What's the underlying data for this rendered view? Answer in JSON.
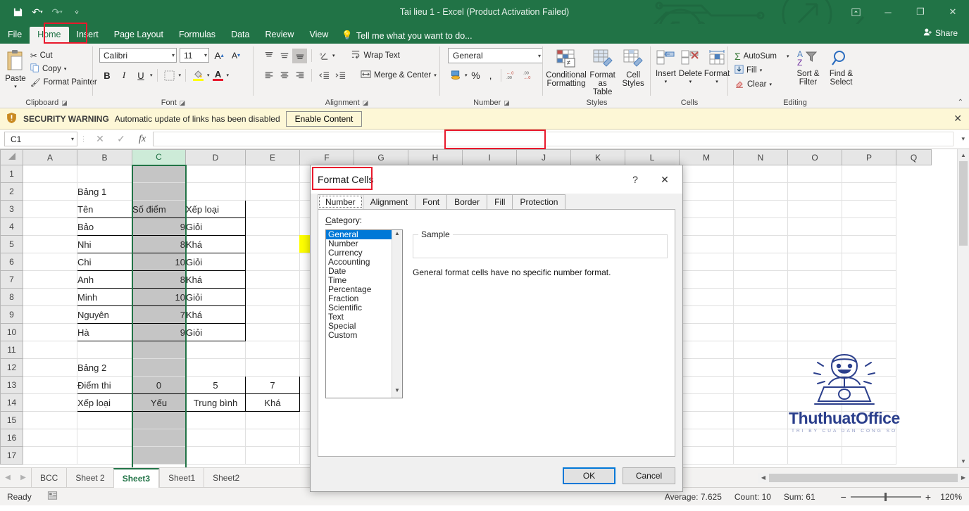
{
  "window": {
    "title": "Tai lieu 1 - Excel (Product Activation Failed)",
    "quick_access": [
      "save-icon",
      "undo-icon",
      "redo-icon",
      "customize-icon"
    ],
    "controls": {
      "ribbon_display": "ribbon-display-icon",
      "minimize": "─",
      "restore": "❐",
      "close": "✕"
    }
  },
  "ribbon_tabs": {
    "items": [
      "File",
      "Home",
      "Insert",
      "Page Layout",
      "Formulas",
      "Data",
      "Review",
      "View"
    ],
    "active": "Home",
    "tell_me": "Tell me what you want to do...",
    "share": "Share"
  },
  "ribbon": {
    "clipboard": {
      "name": "Clipboard",
      "paste": "Paste",
      "cut": "Cut",
      "copy": "Copy",
      "format_painter": "Format Painter"
    },
    "font": {
      "name": "Font",
      "font_family": "Calibri",
      "font_size": "11",
      "grow": "A",
      "shrink": "A",
      "bold": "B",
      "italic": "I",
      "underline": "U"
    },
    "alignment": {
      "name": "Alignment",
      "wrap_text": "Wrap Text",
      "merge_center": "Merge & Center"
    },
    "number": {
      "name": "Number",
      "format": "General",
      "percent": "%",
      "comma": ",",
      "highlighted": true,
      "highlight_color": "#e8192c"
    },
    "styles": {
      "name": "Styles",
      "conditional_formatting": "Conditional\nFormatting",
      "conditional_formatting_l1": "Conditional",
      "conditional_formatting_l2": "Formatting",
      "format_as_table_l1": "Format as",
      "format_as_table_l2": "Table",
      "cell_styles_l1": "Cell",
      "cell_styles_l2": "Styles"
    },
    "cells": {
      "name": "Cells",
      "insert": "Insert",
      "delete": "Delete",
      "format": "Format"
    },
    "editing": {
      "name": "Editing",
      "autosum": "AutoSum",
      "fill": "Fill",
      "clear": "Clear",
      "sort_filter_l1": "Sort &",
      "sort_filter_l2": "Filter",
      "find_select_l1": "Find &",
      "find_select_l2": "Select"
    }
  },
  "security_bar": {
    "label": "SECURITY WARNING",
    "message": "Automatic update of links has been disabled",
    "button": "Enable Content"
  },
  "formula_bar": {
    "name_box": "C1",
    "cancel_icon": "✕",
    "enter_icon": "✓",
    "function_icon": "fx",
    "value": ""
  },
  "grid": {
    "columns": [
      "A",
      "B",
      "C",
      "D",
      "E",
      "F",
      "G",
      "H",
      "I",
      "J",
      "K",
      "L",
      "M",
      "N",
      "O",
      "P",
      "Q"
    ],
    "selected_column": "C",
    "rows": [
      {
        "n": "1",
        "B": "",
        "C": "",
        "D": "",
        "E": ""
      },
      {
        "n": "2",
        "B": "Bảng 1",
        "C": "",
        "D": "",
        "E": ""
      },
      {
        "n": "3",
        "B": "Tên",
        "C": "Số điểm",
        "D": "Xếp loại",
        "E": ""
      },
      {
        "n": "4",
        "B": "Bảo",
        "C": "9",
        "D": "Giỏi",
        "E": ""
      },
      {
        "n": "5",
        "B": "Nhi",
        "C": "8",
        "D": "Khá",
        "E": ""
      },
      {
        "n": "6",
        "B": "Chi",
        "C": "10",
        "D": "Giỏi",
        "E": ""
      },
      {
        "n": "7",
        "B": "Anh",
        "C": "8",
        "D": "Khá",
        "E": ""
      },
      {
        "n": "8",
        "B": "Minh",
        "C": "10",
        "D": "Giỏi",
        "E": ""
      },
      {
        "n": "9",
        "B": "Nguyên",
        "C": "7",
        "D": "Khá",
        "E": ""
      },
      {
        "n": "10",
        "B": "Hà",
        "C": "9",
        "D": "Giỏi",
        "E": ""
      },
      {
        "n": "11",
        "B": "",
        "C": "",
        "D": "",
        "E": ""
      },
      {
        "n": "12",
        "B": "Bảng 2",
        "C": "",
        "D": "",
        "E": ""
      },
      {
        "n": "13",
        "B": "Điểm thi",
        "C": "0",
        "D": "5",
        "E": "7"
      },
      {
        "n": "14",
        "B": "Xếp loại",
        "C": "Yếu",
        "D": "Trung bình",
        "E": "Khá"
      },
      {
        "n": "15",
        "B": "",
        "C": "",
        "D": "",
        "E": ""
      },
      {
        "n": "16",
        "B": "",
        "C": "",
        "D": "",
        "E": ""
      },
      {
        "n": "17",
        "B": "",
        "C": "",
        "D": "",
        "E": ""
      }
    ],
    "highlight_cell": {
      "ref": "F4",
      "color": "#ffff00"
    }
  },
  "watermark": {
    "name": "ThuthuatOffice",
    "tagline": "TRI BY CUA DAN CONG SO"
  },
  "sheet_tabs": {
    "items": [
      "BCC",
      "Sheet 2",
      "Sheet3",
      "Sheet1",
      "Sheet2"
    ],
    "active": "Sheet3"
  },
  "status_bar": {
    "state": "Ready",
    "average": "Average: 7.625",
    "count": "Count: 10",
    "sum": "Sum: 61",
    "zoom": "120%",
    "zoom_out": "−",
    "zoom_in": "+"
  },
  "dialog": {
    "title": "Format Cells",
    "title_highlighted": true,
    "help_icon": "?",
    "close_icon": "✕",
    "tabs": [
      "Number",
      "Alignment",
      "Font",
      "Border",
      "Fill",
      "Protection"
    ],
    "active_tab": "Number",
    "category_label": "Category:",
    "categories": [
      "General",
      "Number",
      "Currency",
      "Accounting",
      "Date",
      "Time",
      "Percentage",
      "Fraction",
      "Scientific",
      "Text",
      "Special",
      "Custom"
    ],
    "selected_category": "General",
    "sample_label": "Sample",
    "sample_value": "",
    "description": "General format cells have no specific number format.",
    "ok": "OK",
    "cancel": "Cancel"
  }
}
